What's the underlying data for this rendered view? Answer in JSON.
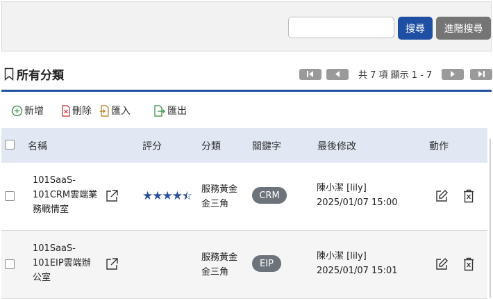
{
  "search": {
    "placeholder": "",
    "search_label": "搜尋",
    "advanced_label": "進階搜尋"
  },
  "page_title": "所有分類",
  "pager": {
    "info": "共 7 項 顯示 1 - 7"
  },
  "toolbar": {
    "add": "新增",
    "delete": "刪除",
    "import": "匯入",
    "export": "匯出"
  },
  "table": {
    "headers": {
      "name": "名稱",
      "rating": "評分",
      "category": "分類",
      "keyword": "關鍵字",
      "modified": "最後修改",
      "action": "動作"
    },
    "rows": [
      {
        "name_lines": [
          "101SaaS-",
          "101CRM雲端業",
          "務戰情室"
        ],
        "rating": 4.5,
        "category_lines": [
          "服務黃金",
          "金三角"
        ],
        "keyword": "CRM",
        "modified_user": "陳小潔 [lily]",
        "modified_time": "2025/01/07 15:00"
      },
      {
        "name_lines": [
          "101SaaS-",
          "101EIP雲端辦",
          "公室"
        ],
        "rating": null,
        "category_lines": [
          "服務黃金",
          "金三角"
        ],
        "keyword": "EIP",
        "modified_user": "陳小潔 [lily]",
        "modified_time": "2025/01/07 15:01"
      }
    ]
  },
  "colors": {
    "primary": "#1f4fa3",
    "secondary_button": "#757575",
    "header_bg": "#e1e8f4",
    "tag": "#6d737a"
  }
}
